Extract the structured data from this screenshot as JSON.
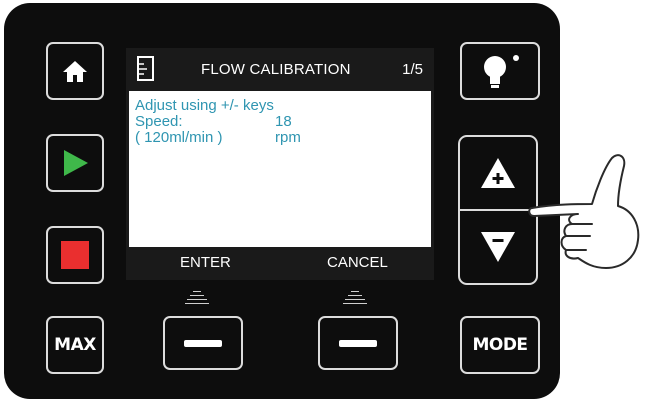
{
  "screen": {
    "title": "FLOW CALIBRATION",
    "page_indicator": "1/5",
    "lines": [
      "Adjust using +/- keys",
      "Speed:",
      "( 120ml/min )"
    ],
    "speed_value": "18 rpm",
    "softkeys": {
      "left": "ENTER",
      "right": "CANCEL"
    }
  },
  "left_buttons": [
    {
      "icon": "home-icon"
    },
    {
      "icon": "play-icon",
      "color": "#3fb84a"
    },
    {
      "icon": "stop-icon",
      "color": "#ea2f2f"
    },
    {
      "label": "MAX"
    }
  ],
  "right_buttons": [
    {
      "icon": "lightbulb-icon"
    },
    {
      "up_icon": "increase-icon",
      "down_icon": "decrease-icon"
    },
    {
      "label": "MODE"
    }
  ],
  "colors": {
    "panel": "#0d0d0d",
    "text_accent": "#2f95b1",
    "lcd_bar": "#1a1a1a"
  }
}
